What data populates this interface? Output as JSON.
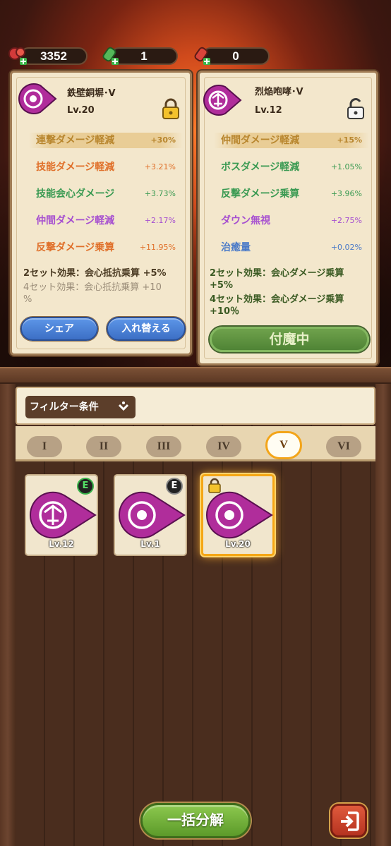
{
  "resources": [
    {
      "icon": "red-gem-plus-icon",
      "value": "3352"
    },
    {
      "icon": "green-potion-plus-icon",
      "value": "1"
    },
    {
      "icon": "red-potion-plus-icon",
      "value": "0"
    }
  ],
  "left_card": {
    "name": "鉄壁銅塀･V",
    "level": "Lv.20",
    "locked": true,
    "stats": [
      {
        "name": "連撃ダメージ軽減",
        "value": "+30%",
        "color": "#b8862e",
        "highlight": true
      },
      {
        "name": "技能ダメージ軽減",
        "value": "+3.21%",
        "color": "#e0702a",
        "highlight": false
      },
      {
        "name": "技能会心ダメージ",
        "value": "+3.73%",
        "color": "#3a9a52",
        "highlight": false
      },
      {
        "name": "仲間ダメージ軽減",
        "value": "+2.17%",
        "color": "#a64fd0",
        "highlight": false
      },
      {
        "name": "反撃ダメージ乗算",
        "value": "+11.95%",
        "color": "#e0702a",
        "highlight": false
      }
    ],
    "set2": "2セット効果：会心抵抗乗算 +5%",
    "set4_line1": "4セット効果：会心抵抗乗算 +10",
    "set4_line2": "%",
    "share_label": "シェア",
    "swap_label": "入れ替える"
  },
  "right_card": {
    "name": "烈焔咆哮･V",
    "level": "Lv.12",
    "locked": false,
    "stats": [
      {
        "name": "仲間ダメージ軽減",
        "value": "+15%",
        "color": "#b8862e",
        "highlight": true
      },
      {
        "name": "ボスダメージ軽減",
        "value": "+1.05%",
        "color": "#3a9a52",
        "highlight": false
      },
      {
        "name": "反撃ダメージ乗算",
        "value": "+3.96%",
        "color": "#3a9a52",
        "highlight": false
      },
      {
        "name": "ダウン無視",
        "value": "+2.75%",
        "color": "#a64fd0",
        "highlight": false
      },
      {
        "name": "治癒量",
        "value": "+0.02%",
        "color": "#4a7ac8",
        "highlight": false
      }
    ],
    "set2_line1": "2セット効果：会心ダメージ乗算",
    "set2_line2": "+5%",
    "set4_line1": "4セット効果：会心ダメージ乗算",
    "set4_line2": "+10％",
    "enchant_label": "付魔中"
  },
  "filter": {
    "label": "フィルター条件"
  },
  "tiers": [
    "I",
    "II",
    "III",
    "IV",
    "V",
    "VI"
  ],
  "active_tier": "V",
  "items": [
    {
      "level": "Lv.12",
      "badge": "E",
      "badge_color": "#39b34a",
      "locked": false,
      "selected": false
    },
    {
      "level": "Lv.1",
      "badge": "E",
      "badge_color": "#8a8a8a",
      "locked": false,
      "selected": false
    },
    {
      "level": "Lv.20",
      "badge": "",
      "locked": true,
      "selected": true
    }
  ],
  "bottom": {
    "bulk_dismantle_label": "一括分解",
    "exit_icon": "exit-icon"
  }
}
